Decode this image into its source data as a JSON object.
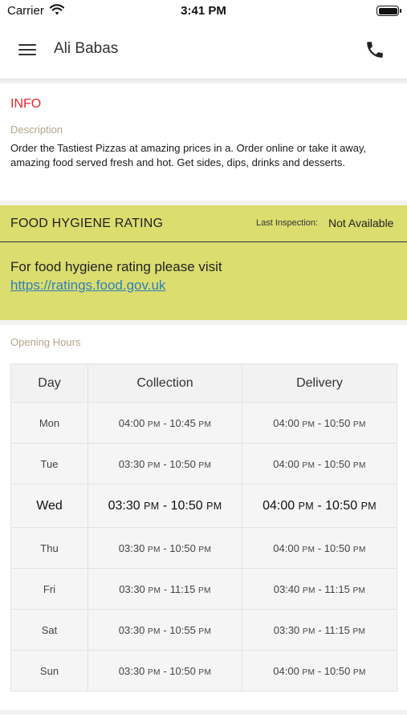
{
  "status_bar": {
    "carrier": "Carrier",
    "time": "3:41 PM"
  },
  "nav": {
    "title": "Ali Babas",
    "menu_icon": "hamburger-menu-icon",
    "call_icon": "phone-icon"
  },
  "info": {
    "heading": "INFO",
    "description_label": "Description",
    "description": "Order the Tastiest Pizzas at amazing prices in a. Order online or take it away, amazing food served fresh and hot. Get sides, dips, drinks and desserts."
  },
  "hygiene": {
    "title": "FOOD HYGIENE RATING",
    "last_inspection_label": "Last Inspection:",
    "last_inspection_value": "Not Available",
    "text": "For food hygiene rating please visit",
    "link": "https://ratings.food.gov.uk"
  },
  "opening_hours": {
    "label": "Opening Hours",
    "headers": [
      "Day",
      "Collection",
      "Delivery"
    ],
    "rows": [
      {
        "day": "Mon",
        "collection": "04:00 PM - 10:45 PM",
        "delivery": "04:00 PM - 10:50 PM"
      },
      {
        "day": "Tue",
        "collection": "03:30 PM - 10:50 PM",
        "delivery": "04:00 PM - 10:50 PM"
      },
      {
        "day": "Wed",
        "collection": "03:30 PM - 10:50 PM",
        "delivery": "04:00 PM - 10:50 PM",
        "today": true
      },
      {
        "day": "Thu",
        "collection": "03:30 PM - 10:50 PM",
        "delivery": "04:00 PM - 10:50 PM"
      },
      {
        "day": "Fri",
        "collection": "03:30 PM - 11:15 PM",
        "delivery": "03:40 PM - 11:15 PM"
      },
      {
        "day": "Sat",
        "collection": "03:30 PM - 10:55 PM",
        "delivery": "03:30 PM - 11:15 PM"
      },
      {
        "day": "Sun",
        "collection": "03:30 PM - 10:50 PM",
        "delivery": "04:00 PM - 10:50 PM"
      }
    ]
  },
  "colors": {
    "accent_red": "#e5262d",
    "hygiene_bg": "#dbdd6f",
    "label_tan": "#b3a58a",
    "link_blue": "#2f7fb8"
  }
}
